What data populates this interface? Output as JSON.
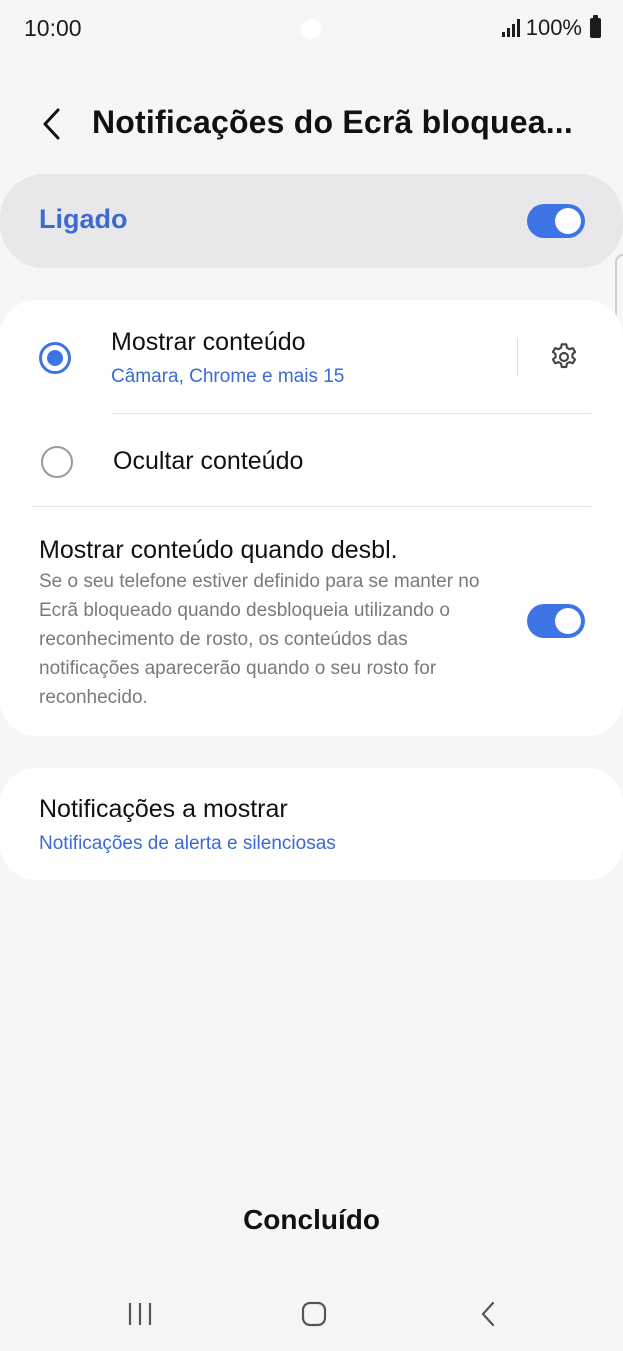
{
  "status_bar": {
    "time": "10:00",
    "battery": "100%",
    "icons": [
      "signal-icon",
      "battery-icon"
    ]
  },
  "header": {
    "title": "Notificações do Ecrã bloquea...",
    "back_icon": "chevron-left-icon"
  },
  "master_toggle": {
    "label": "Ligado",
    "on": true
  },
  "options": {
    "show_content": {
      "title": "Mostrar conteúdo",
      "subtitle": "Câmara, Chrome e mais 15",
      "selected": true
    },
    "hide_content": {
      "title": "Ocultar conteúdo",
      "selected": false
    }
  },
  "unlock_setting": {
    "title": "Mostrar conteúdo quando desbl.",
    "description": "Se o seu telefone estiver definido para se manter no Ecrã bloqueado quando desbloqueia utilizando o reconhecimento de rosto, os conteúdos das notificações aparecerão quando o seu rosto for reconhecido.",
    "on": true
  },
  "notifications_to_show": {
    "title": "Notificações a mostrar",
    "value": "Notificações de alerta e silenciosas"
  },
  "done_label": "Concluído",
  "nav": {
    "recents_icon": "recents-icon",
    "home_icon": "home-icon",
    "back_icon": "back-icon"
  },
  "colors": {
    "accent": "#3e74e6",
    "link": "#3a6ad2",
    "background": "#f6f6f8",
    "card": "#ffffff",
    "master_card": "#e8e8ea"
  }
}
